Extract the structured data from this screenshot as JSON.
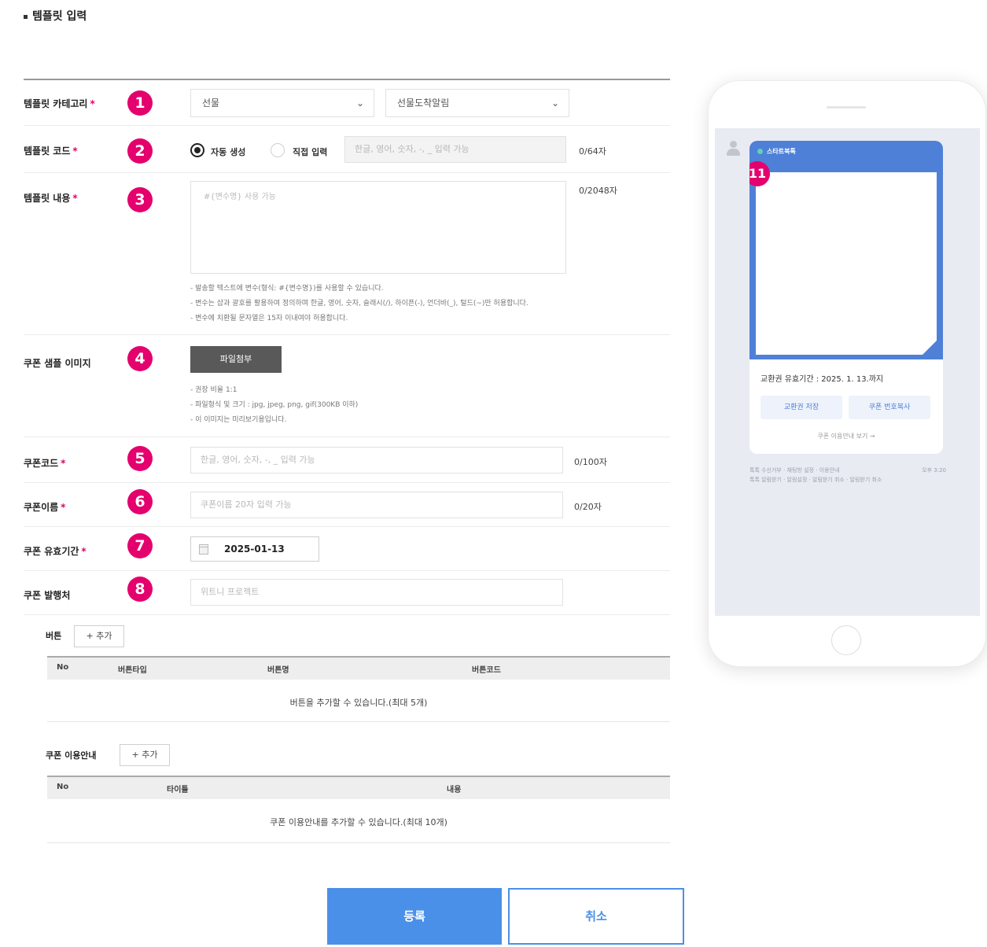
{
  "section_title": "템플릿 입력",
  "form": {
    "category": {
      "label": "템플릿 카테고리",
      "badge": "1",
      "select1": "선물",
      "select2": "선물도착알림"
    },
    "code": {
      "label": "템플릿 코드",
      "badge": "2",
      "radio_auto": "자동 생성",
      "radio_manual": "직접 입력",
      "placeholder": "한글, 영어, 숫자, -, _ 입력 가능",
      "counter": "0/64자"
    },
    "content": {
      "label": "템플릿 내용",
      "badge": "3",
      "placeholder": "#{변수명} 사용 가능",
      "counter": "0/2048자",
      "help": [
        "- 발송할 텍스트에 변수(형식: #{변수명})를 사용할 수 있습니다.",
        "- 변수는 샵과 괄호를 활용하여 정의하며 한글, 영어, 숫자, 슬래시(/), 하이픈(-), 언더바(_), 털드(~)만 허용합니다.",
        "- 변수에 치환될 문자열은 15자 이내여야 허용합니다."
      ]
    },
    "image": {
      "label": "쿠폰 샘플 이미지",
      "badge": "4",
      "button": "파일첨부",
      "help": [
        "- 권장 비율 1:1",
        "- 파일형식 및 크기 : jpg, jpeg, png, gif(300KB 이하)",
        "- 이 이미지는 미리보기용입니다."
      ]
    },
    "coupon_code": {
      "label": "쿠폰코드",
      "badge": "5",
      "placeholder": "한글, 영어, 숫자, -, _ 입력 가능",
      "counter": "0/100자"
    },
    "coupon_name": {
      "label": "쿠폰이름",
      "badge": "6",
      "placeholder": "쿠폰이름 20자 입력 가능",
      "counter": "0/20자"
    },
    "validity": {
      "label": "쿠폰 유효기간",
      "badge": "7",
      "value": "2025-01-13"
    },
    "issuer": {
      "label": "쿠폰 발행처",
      "badge": "8",
      "placeholder": "위트니 프로젝트"
    },
    "required_mark": "*"
  },
  "buttons_section": {
    "label": "버튼",
    "add": "+ 추가",
    "headers": [
      "No",
      "버튼타입",
      "버튼명",
      "버튼코드"
    ],
    "empty": "버튼을 추가할 수 있습니다.(최대 5개)"
  },
  "guide_section": {
    "label": "쿠폰 이용안내",
    "add": "+ 추가",
    "headers": [
      "No",
      "타이틀",
      "내용"
    ],
    "empty": "쿠폰 이용안내를 추가할 수 있습니다.(최대 10개)"
  },
  "actions": {
    "submit": "등록",
    "cancel": "취소"
  },
  "preview": {
    "badge": "11",
    "chip": "스타트북톡",
    "validity": "교환권 유효기간 : 2025. 1. 13.까지",
    "btn1": "교환권 저장",
    "btn2": "쿠폰 번호복사",
    "link": "쿠폰 이용안내 보기 →",
    "foot1_left": "톡톡 수신거부 · 채팅방 설정 · 이용안내",
    "foot1_right": "오후 3:20",
    "foot2": "톡톡 알림받기 · 알림설정 · 알림받기 취소 · 알림받기 취소"
  },
  "colors": {
    "badge": "#e4006d",
    "primary": "#4a90e8",
    "card": "#4e80d8"
  }
}
